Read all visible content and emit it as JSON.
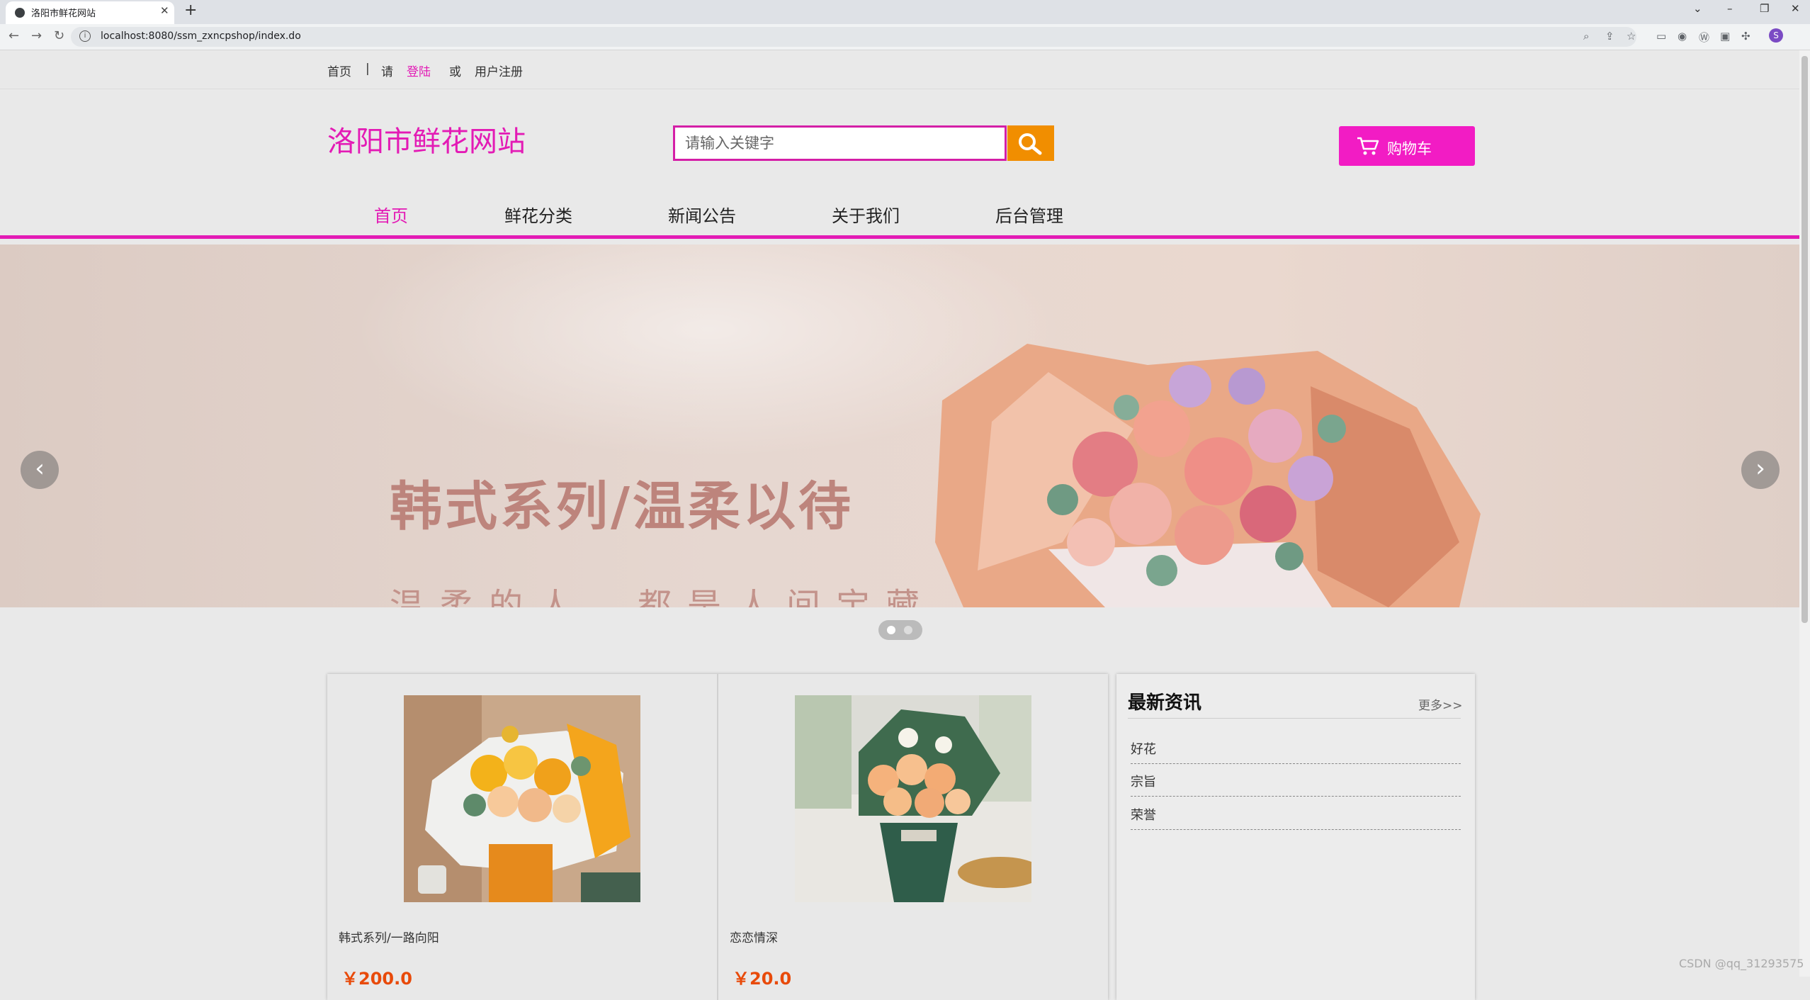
{
  "browser": {
    "tab_title": "洛阳市鲜花网站",
    "url": "localhost:8080/ssm_zxncpshop/index.do",
    "profile_initial": "S"
  },
  "topbar": {
    "home": "首页",
    "separator": "|",
    "please": "请",
    "login": "登陆",
    "or": "或",
    "register": "用户注册"
  },
  "header": {
    "logo": "洛阳市鲜花网站",
    "search_placeholder": "请输入关键字",
    "cart_label": "购物车"
  },
  "nav": {
    "items": [
      {
        "label": "首页",
        "active": true
      },
      {
        "label": "鲜花分类",
        "active": false
      },
      {
        "label": "新闻公告",
        "active": false
      },
      {
        "label": "关于我们",
        "active": false
      },
      {
        "label": "后台管理",
        "active": false
      }
    ]
  },
  "banner": {
    "heading": "韩式系列/温柔以待",
    "subheading": "温柔的人，都是人间宝藏",
    "slide_count": 2,
    "active_slide": 1
  },
  "products": [
    {
      "name": "韩式系列/一路向阳",
      "price": "￥200.0"
    },
    {
      "name": "恋恋情深",
      "price": "￥20.0"
    }
  ],
  "news": {
    "title": "最新资讯",
    "more": "更多>>",
    "items": [
      "好花",
      "宗旨",
      "荣誉"
    ]
  },
  "watermark": "CSDN @qq_31293575",
  "colors": {
    "brand": "#e31bb5",
    "cart": "#f21cc4",
    "search_button": "#f18e00",
    "price": "#e84a0a"
  }
}
